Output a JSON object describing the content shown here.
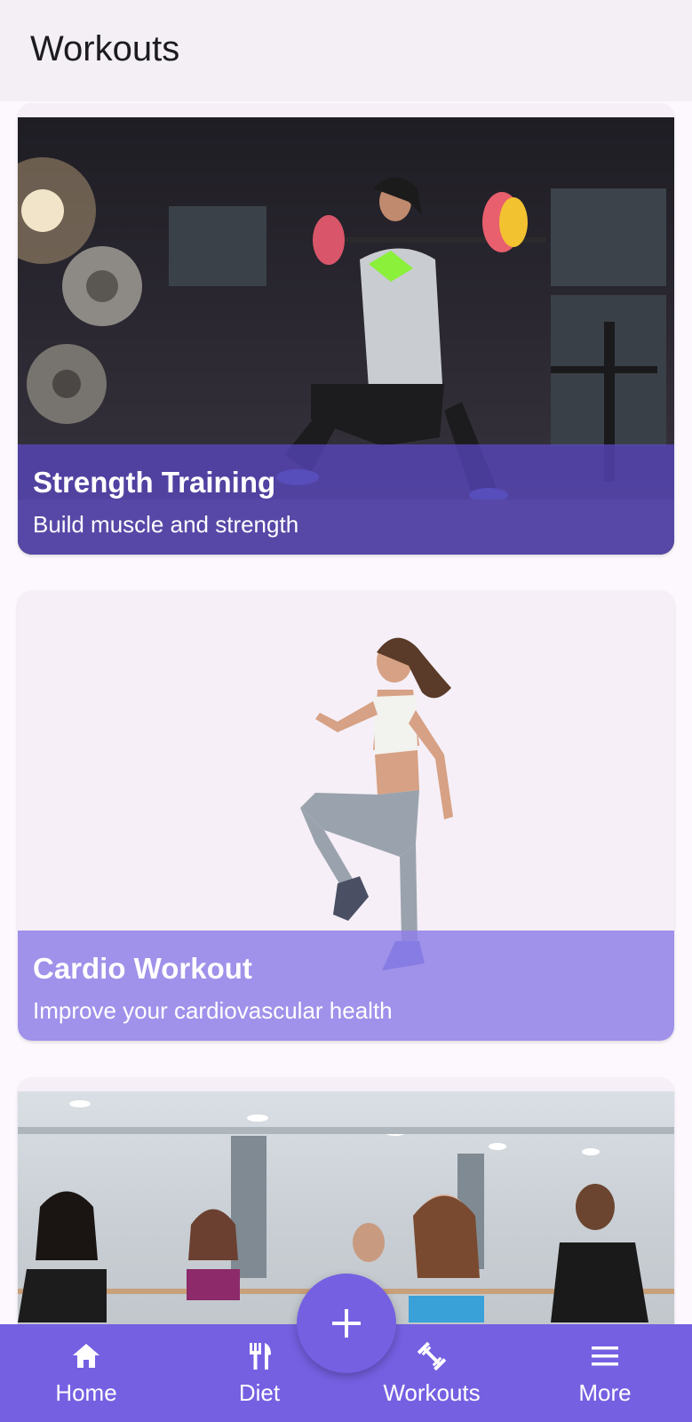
{
  "app_bar": {
    "title": "Workouts"
  },
  "cards": [
    {
      "title": "Strength Training",
      "subtitle": "Build muscle and strength",
      "image_icon": "strength-training-photo"
    },
    {
      "title": "Cardio Workout",
      "subtitle": "Improve your cardiovascular health",
      "image_icon": "cardio-workout-photo"
    },
    {
      "title": "",
      "subtitle": "",
      "image_icon": "group-fitness-class-photo"
    }
  ],
  "fab": {
    "icon": "plus-icon"
  },
  "bottom_nav": {
    "items": [
      {
        "label": "Home",
        "icon": "home-icon"
      },
      {
        "label": "Diet",
        "icon": "fork-knife-icon"
      },
      {
        "label": "Workouts",
        "icon": "dumbbell-icon"
      },
      {
        "label": "More",
        "icon": "menu-icon"
      }
    ]
  },
  "colors": {
    "accent": "#7560e2",
    "app_bar_bg": "#f3eff4",
    "page_bg": "#fcf8fd",
    "card_bg": "#f6eff7"
  }
}
